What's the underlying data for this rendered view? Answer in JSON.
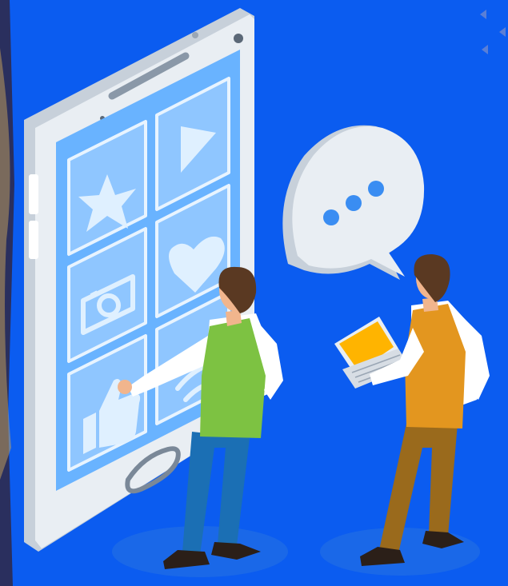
{
  "colors": {
    "background": "#0b5cf0",
    "left_edge": "#2a2f5e",
    "phone_body": "#e9eef3",
    "phone_side": "#c7d0da",
    "screen": "#69b3ff",
    "screen_tile": "#8fc6ff",
    "screen_tile_stroke": "#e8f4ff",
    "bubble": "#e9eef3",
    "bubble_dots": "#3a8df2",
    "vest_green": "#7dc242",
    "vest_orange": "#e3961f",
    "pants_blue": "#1b6fb4",
    "pants_brown": "#9a6a1c",
    "skin": "#f1b58d",
    "hair": "#5a3922",
    "laptop_screen": "#ffb400",
    "floor_shadow": "#1a68e8"
  },
  "icons": [
    "star-icon",
    "play-icon",
    "camera-icon",
    "heart-icon",
    "like-icon",
    "wifi-icon",
    "chat-dots-icon",
    "laptop-icon"
  ]
}
